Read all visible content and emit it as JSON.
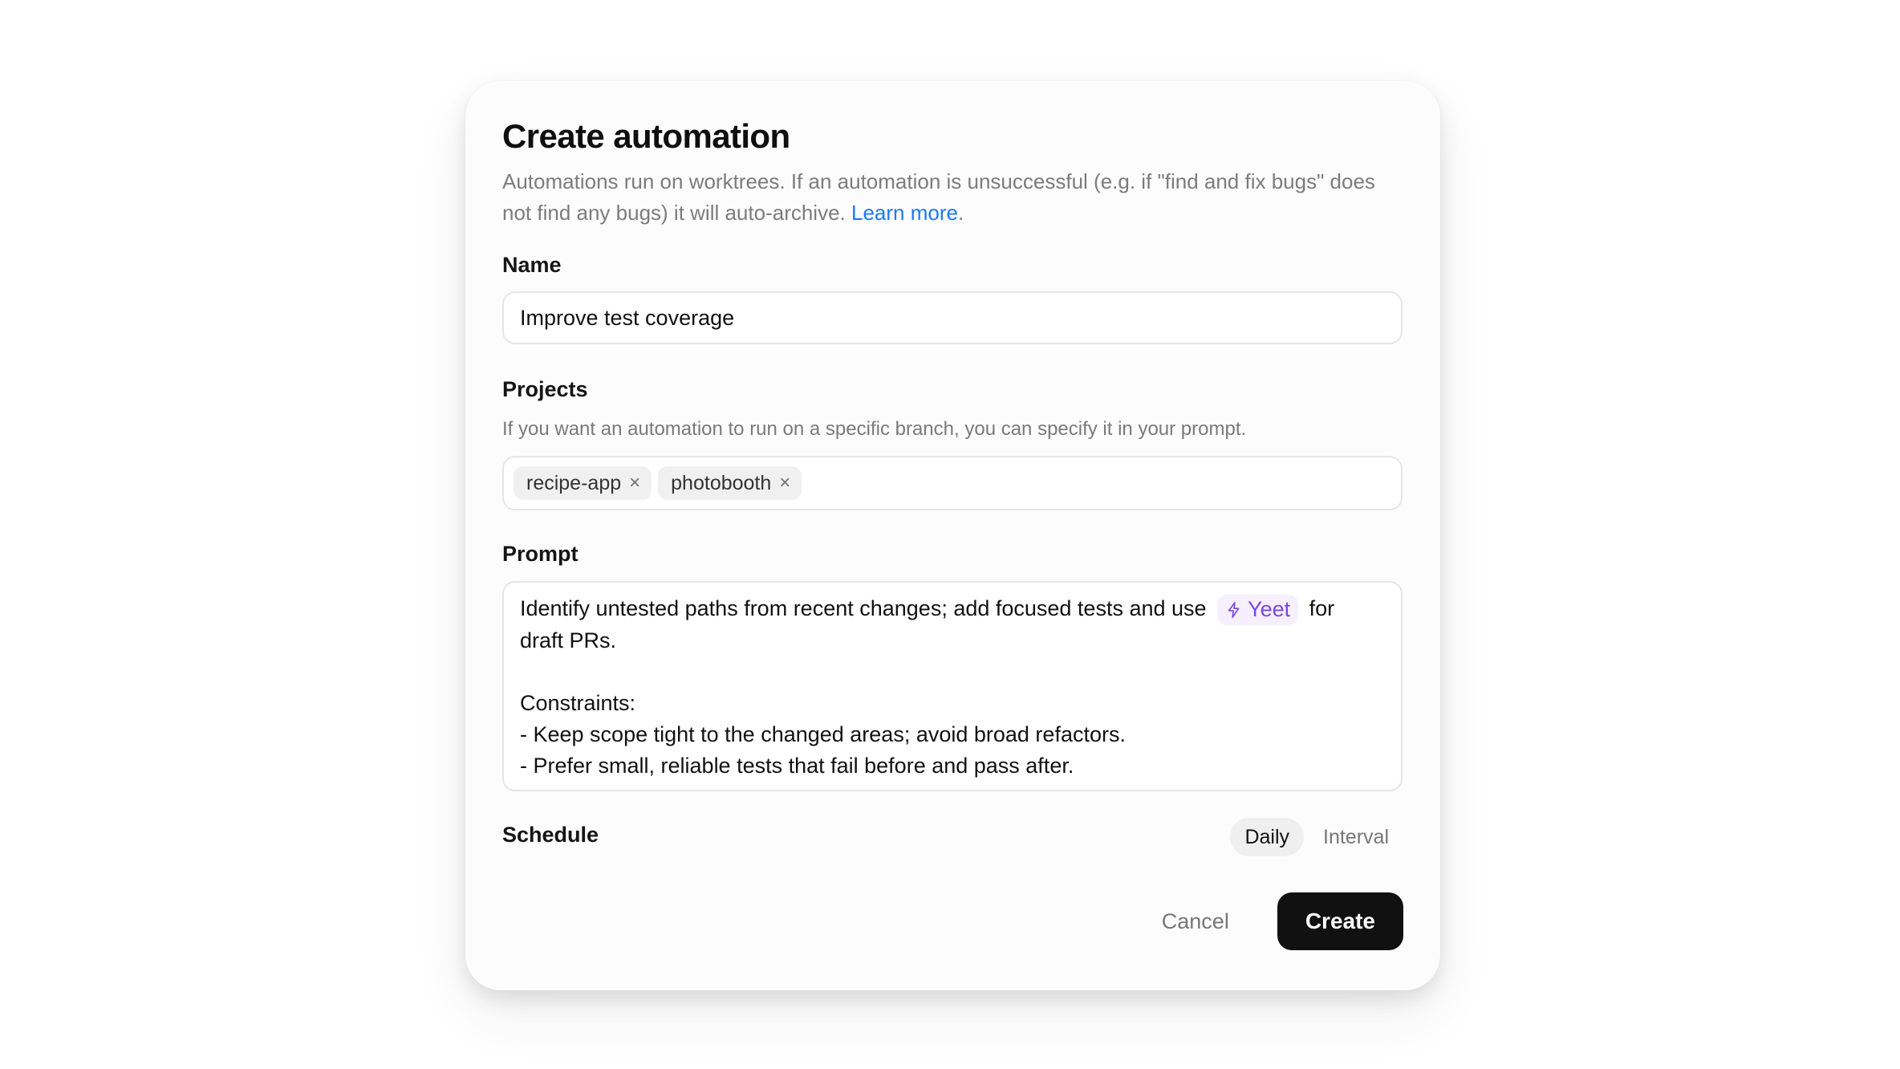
{
  "dialog": {
    "title": "Create automation",
    "description_text": "Automations run on worktrees. If an automation is unsuccessful (e.g. if \"find and fix bugs\" does not find any bugs) it will auto-archive. ",
    "learn_more": "Learn more",
    "description_period": "."
  },
  "name": {
    "label": "Name",
    "value": "Improve test coverage"
  },
  "projects": {
    "label": "Projects",
    "help": "If you want an automation to run on a specific branch, you can specify it in your prompt.",
    "items": [
      {
        "label": "recipe-app",
        "remove": "×"
      },
      {
        "label": "photobooth",
        "remove": "×"
      }
    ]
  },
  "prompt": {
    "label": "Prompt",
    "before_chip": "Identify untested paths from recent changes; add focused tests and use",
    "chip": {
      "label": "Yeet",
      "icon": "lightning-icon"
    },
    "after_chip": "for",
    "second_line": "draft PRs.",
    "constraints_title": "Constraints:",
    "constraints": [
      "- Keep scope tight to the changed areas; avoid broad refactors.",
      "- Prefer small, reliable tests that fail before and pass after."
    ]
  },
  "schedule": {
    "label": "Schedule",
    "options": [
      "Daily",
      "Interval"
    ],
    "selected": "Daily"
  },
  "actions": {
    "cancel": "Cancel",
    "create": "Create"
  },
  "colors": {
    "link": "#1f78f0",
    "chip_accent": "#7b48dc",
    "primary_button": "#111111"
  }
}
